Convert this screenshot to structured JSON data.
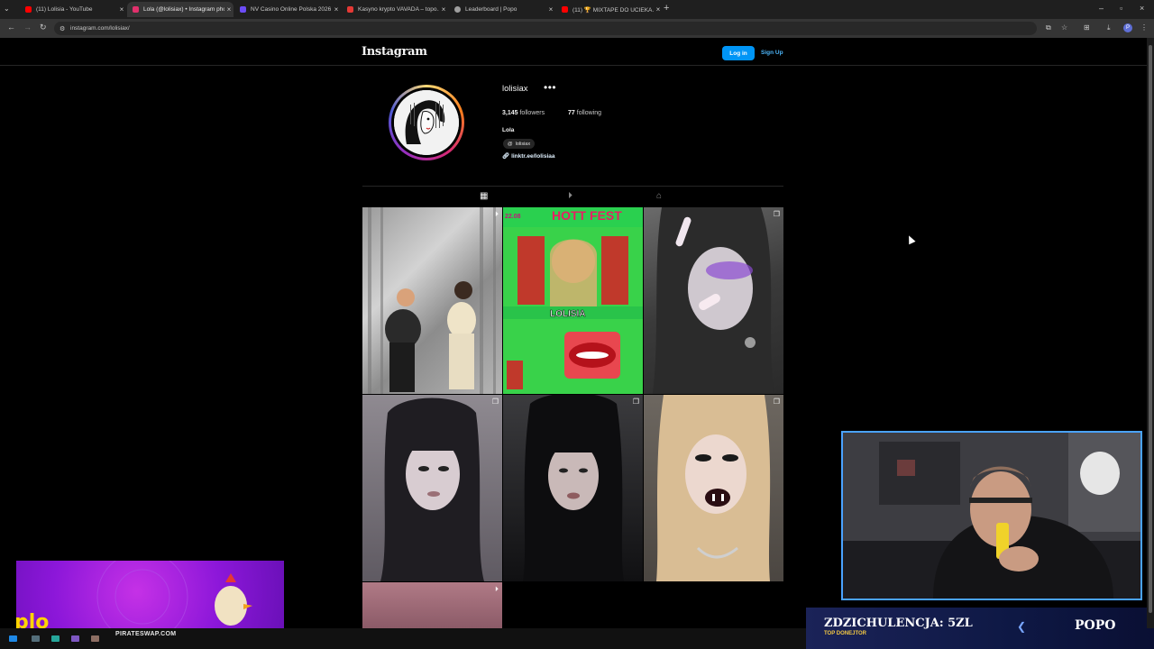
{
  "browser": {
    "tabs": [
      {
        "title": "(11) Lolisia - YouTube",
        "color": "#ff0000"
      },
      {
        "title": "Lola (@lolisiax) • Instagram photos",
        "color": "#e1306c"
      },
      {
        "title": "NV Casino Online Polska 2026 | ...",
        "color": "#6b4cf5"
      },
      {
        "title": "Kasyno krypto VAVADA – topo...",
        "color": "#e53935"
      },
      {
        "title": "Leaderboard | Popo",
        "color": "#9e9e9e"
      },
      {
        "title": "(11) 🏆 MIXTAPE DO UCIEKA...",
        "color": "#ff0000"
      }
    ],
    "new_tab_label": "+",
    "url": "instagram.com/lolisiax/",
    "profile_initial": "P"
  },
  "instagram": {
    "logo": "Instagram",
    "login_label": "Log in",
    "signup_label": "Sign Up",
    "username": "lolisiax",
    "more_label": "•••",
    "followers_count": "3,145",
    "followers_label": "followers",
    "following_count": "77",
    "following_label": "following",
    "full_name": "Lola",
    "threads_handle": "lolisiax",
    "link": "linktr.ee/lolisiaa",
    "post_tabs": [
      "posts-grid",
      "reels",
      "tagged"
    ]
  },
  "posts": [
    {
      "type": "reel"
    },
    {
      "type": "poster",
      "headline": "HOTT FEST",
      "date": "22.08",
      "name": "LOLISIA"
    },
    {
      "type": "carousel"
    },
    {
      "type": "carousel"
    },
    {
      "type": "carousel"
    },
    {
      "type": "carousel"
    },
    {
      "type": "reel"
    }
  ],
  "stream_overlay": {
    "promo_text": "plo",
    "pirate_text": "PIRATESWAP.COM",
    "donor_title": "ZDZICHULENCJA: 5ZL",
    "donor_subtitle": "TOP DONEJTOR",
    "streamer_name": "POPO"
  }
}
